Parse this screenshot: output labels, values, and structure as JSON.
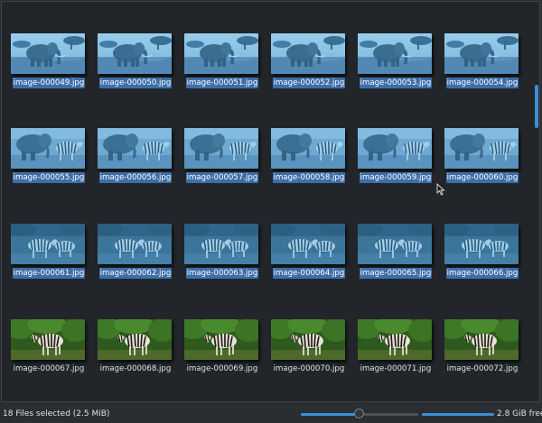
{
  "files": [
    {
      "name": "image-000049.jpg",
      "scene": "elephant",
      "selected": true
    },
    {
      "name": "image-000050.jpg",
      "scene": "elephant",
      "selected": true
    },
    {
      "name": "image-000051.jpg",
      "scene": "elephant",
      "selected": true
    },
    {
      "name": "image-000052.jpg",
      "scene": "elephant",
      "selected": true
    },
    {
      "name": "image-000053.jpg",
      "scene": "elephant",
      "selected": true
    },
    {
      "name": "image-000054.jpg",
      "scene": "elephant",
      "selected": true
    },
    {
      "name": "image-000055.jpg",
      "scene": "elephant-zebra",
      "selected": true
    },
    {
      "name": "image-000056.jpg",
      "scene": "elephant-zebra",
      "selected": true
    },
    {
      "name": "image-000057.jpg",
      "scene": "elephant-zebra",
      "selected": true
    },
    {
      "name": "image-000058.jpg",
      "scene": "elephant-zebra",
      "selected": true
    },
    {
      "name": "image-000059.jpg",
      "scene": "elephant-zebra",
      "selected": true
    },
    {
      "name": "image-000060.jpg",
      "scene": "elephant-zebra",
      "selected": true
    },
    {
      "name": "image-000061.jpg",
      "scene": "zebras",
      "selected": true
    },
    {
      "name": "image-000062.jpg",
      "scene": "zebras",
      "selected": true
    },
    {
      "name": "image-000063.jpg",
      "scene": "zebras",
      "selected": true
    },
    {
      "name": "image-000064.jpg",
      "scene": "zebras",
      "selected": true
    },
    {
      "name": "image-000065.jpg",
      "scene": "zebras",
      "selected": true
    },
    {
      "name": "image-000066.jpg",
      "scene": "zebras",
      "selected": true
    },
    {
      "name": "image-000067.jpg",
      "scene": "zebra-green",
      "selected": false
    },
    {
      "name": "image-000068.jpg",
      "scene": "zebra-green",
      "selected": false
    },
    {
      "name": "image-000069.jpg",
      "scene": "zebra-green",
      "selected": false
    },
    {
      "name": "image-000070.jpg",
      "scene": "zebra-green",
      "selected": false
    },
    {
      "name": "image-000071.jpg",
      "scene": "zebra-green",
      "selected": false
    },
    {
      "name": "image-000072.jpg",
      "scene": "zebra-green",
      "selected": false
    }
  ],
  "status": {
    "selection_text": "18 Files selected (2.5 MiB)",
    "free_space_text": "2.8 GiB free",
    "zoom_level_fraction": 0.5,
    "disk_used_fraction": 1.0
  },
  "colors": {
    "accent": "#3d8ed4",
    "selection": "#3d6ea8",
    "background": "#22262a"
  },
  "icons": {
    "cursor": "arrow-pointer-icon"
  }
}
